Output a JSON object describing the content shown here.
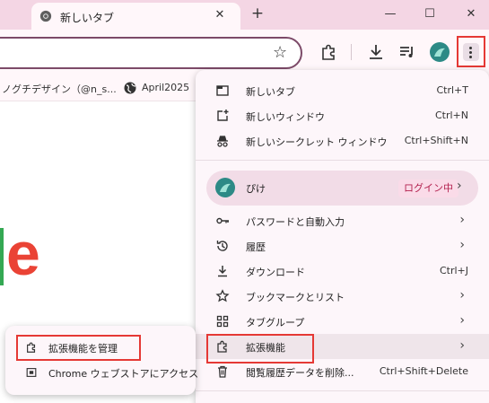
{
  "tab": {
    "title": "新しいタブ",
    "close": "✕"
  },
  "tabstrip": {
    "new_tab": "+",
    "minimize": "—",
    "maximize": "☐",
    "close": "✕"
  },
  "toolbar": {
    "star": "☆"
  },
  "bookmarks": [
    {
      "label": "ノグチデザイン（@n_s..."
    },
    {
      "label": "April2025"
    }
  ],
  "page": {
    "logo_letter": "e"
  },
  "menu": {
    "items": [
      {
        "icon": "new-tab-icon",
        "label": "新しいタブ",
        "shortcut": "Ctrl+T"
      },
      {
        "icon": "new-window-icon",
        "label": "新しいウィンドウ",
        "shortcut": "Ctrl+N"
      },
      {
        "icon": "incognito-icon",
        "label": "新しいシークレット ウィンドウ",
        "shortcut": "Ctrl+Shift+N"
      }
    ],
    "profile": {
      "name": "ぴけ",
      "status": "ログイン中"
    },
    "items2": [
      {
        "icon": "key-icon",
        "label": "パスワードと自動入力",
        "shortcut": ""
      },
      {
        "icon": "history-icon",
        "label": "履歴",
        "shortcut": ""
      },
      {
        "icon": "download-icon",
        "label": "ダウンロード",
        "shortcut": "Ctrl+J"
      },
      {
        "icon": "bookmark-star-icon",
        "label": "ブックマークとリスト",
        "shortcut": ""
      },
      {
        "icon": "tab-group-icon",
        "label": "タブグループ",
        "shortcut": ""
      },
      {
        "icon": "extensions-icon",
        "label": "拡張機能",
        "shortcut": ""
      },
      {
        "icon": "trash-icon",
        "label": "閲覧履歴データを削除...",
        "shortcut": "Ctrl+Shift+Delete"
      }
    ]
  },
  "submenu": {
    "items": [
      {
        "icon": "extensions-icon",
        "label": "拡張機能を管理"
      },
      {
        "icon": "store-icon",
        "label": "Chrome ウェブストアにアクセス"
      }
    ]
  },
  "colors": {
    "accent_red": "#e53935",
    "tabstrip": "#f4d6e4",
    "highlight": "#efe5ea"
  }
}
